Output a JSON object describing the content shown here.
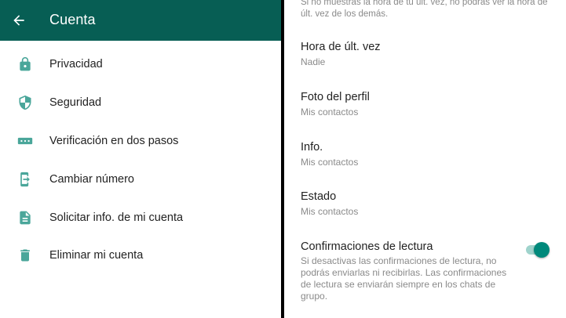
{
  "header": {
    "title": "Cuenta",
    "bar_color": "#075e54"
  },
  "icons": {
    "back": "arrow-left-icon",
    "accent": "#4aa69a"
  },
  "menu": {
    "items": [
      {
        "label": "Privacidad",
        "icon": "lock-icon"
      },
      {
        "label": "Seguridad",
        "icon": "shield-icon"
      },
      {
        "label": "Verificación en dos pasos",
        "icon": "password-dots-icon"
      },
      {
        "label": "Cambiar número",
        "icon": "phone-change-icon"
      },
      {
        "label": "Solicitar info. de mi cuenta",
        "icon": "document-icon"
      },
      {
        "label": "Eliminar mi cuenta",
        "icon": "trash-icon"
      }
    ]
  },
  "privacy": {
    "top_note": "Si no muestras la hora de tu últ. vez, no podrás ver la hora de últ. vez de los demás.",
    "settings": [
      {
        "title": "Hora de últ. vez",
        "value": "Nadie"
      },
      {
        "title": "Foto del perfil",
        "value": "Mis contactos"
      },
      {
        "title": "Info.",
        "value": "Mis contactos"
      },
      {
        "title": "Estado",
        "value": "Mis contactos"
      }
    ],
    "read_receipts": {
      "title": "Confirmaciones de lectura",
      "description": "Si desactivas las confirmaciones de lectura, no podrás enviarlas ni recibirlas. Las confirmaciones de lectura se enviarán siempre en los chats de grupo.",
      "enabled": true
    }
  }
}
